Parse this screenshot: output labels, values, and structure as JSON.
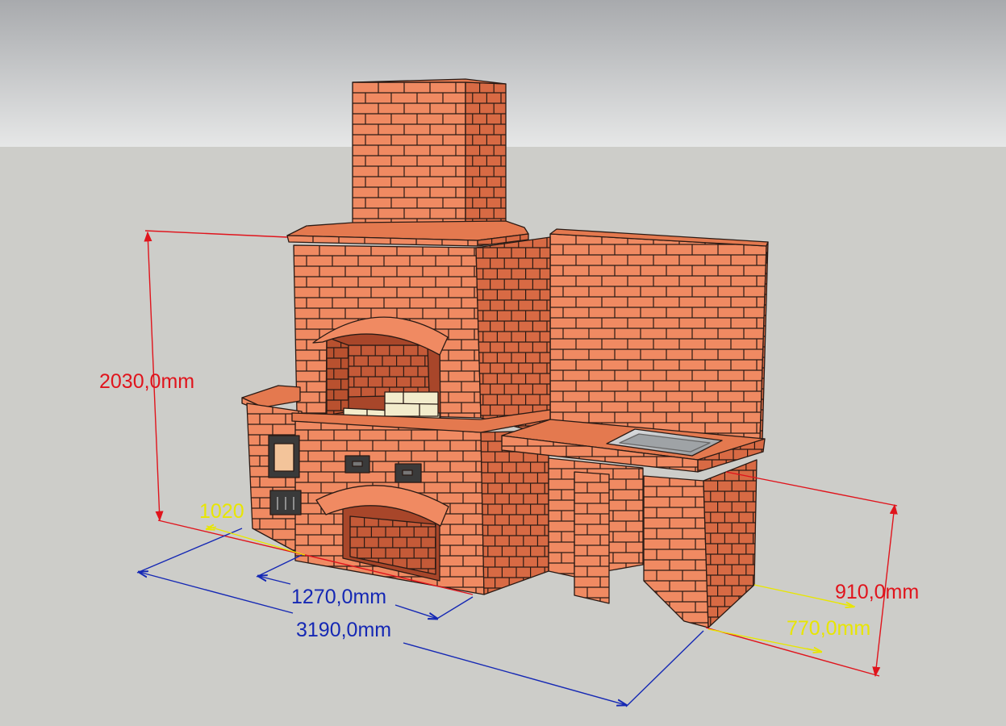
{
  "dimensions": {
    "total_height": "2030,0mm",
    "counter_height": "910,0mm",
    "total_length": "3190,0mm",
    "grill_width": "1270,0mm",
    "side_depth": "1020",
    "counter_depth": "770,0mm"
  },
  "colors": {
    "sky_top": "#a8aaad",
    "sky_bottom": "#e6e7e7",
    "ground": "#cdcdc9",
    "brick_front": "#f08a62",
    "brick_side": "#d86a44",
    "brick_top": "#e4794f",
    "mortar": "#2a1a14",
    "height_dimension": "#e0141c",
    "length_dimension": "#1528b4",
    "depth_dimension": "#e8e600",
    "firebrick": "#f3eccc",
    "sink_steel": "#b9bcc0",
    "cast_iron": "#3a3a3a"
  }
}
